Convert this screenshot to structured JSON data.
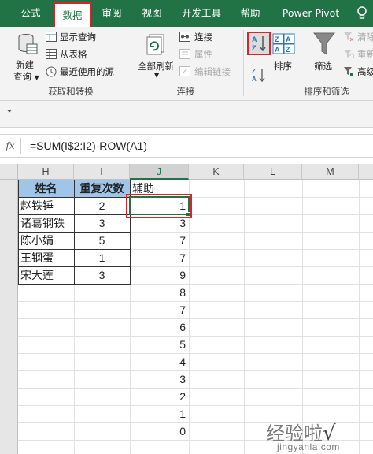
{
  "tabs": [
    {
      "label": "公式",
      "active": false
    },
    {
      "label": "数据",
      "active": true
    },
    {
      "label": "审阅",
      "active": false
    },
    {
      "label": "视图",
      "active": false
    },
    {
      "label": "开发工具",
      "active": false
    },
    {
      "label": "帮助",
      "active": false
    },
    {
      "label": "Power Pivot",
      "active": false
    }
  ],
  "ribbon": {
    "get_transform": {
      "new_query_line1": "新建",
      "new_query_line2": "查询",
      "show_queries": "显示查询",
      "from_table": "从表格",
      "recent_sources": "最近使用的源",
      "group_label": "获取和转换"
    },
    "connections": {
      "refresh_all": "全部刷新",
      "connections": "连接",
      "properties": "属性",
      "edit_links": "编辑链接",
      "group_label": "连接"
    },
    "sort_filter": {
      "sort": "排序",
      "filter": "筛选",
      "clear": "清除",
      "reapply": "重新",
      "advanced": "高级",
      "group_label": "排序和筛选"
    }
  },
  "formula_bar": {
    "fx_label": "fx",
    "formula": "=SUM(I$2:I2)-ROW(A1)"
  },
  "columns": [
    "H",
    "I",
    "J",
    "K",
    "L",
    "M"
  ],
  "selected_column": "J",
  "table": {
    "headers": {
      "name": "姓名",
      "repeat": "重复次数",
      "helper": "辅助"
    },
    "rows": [
      {
        "name": "赵铁锤",
        "repeat": "2"
      },
      {
        "name": "诸葛钢铁",
        "repeat": "3"
      },
      {
        "name": "陈小娟",
        "repeat": "5"
      },
      {
        "name": "王钢蛋",
        "repeat": "1"
      },
      {
        "name": "宋大莲",
        "repeat": "3"
      }
    ]
  },
  "helper_values": [
    "1",
    "3",
    "7",
    "7",
    "9",
    "8",
    "7",
    "6",
    "5",
    "4",
    "3",
    "2",
    "1",
    "0"
  ],
  "watermark": {
    "main": "经验啦",
    "check": "√",
    "sub": "jingyanla.com"
  },
  "colors": {
    "accent": "#217346",
    "highlight": "#d9242a",
    "header_fill": "#9fc5e8"
  }
}
